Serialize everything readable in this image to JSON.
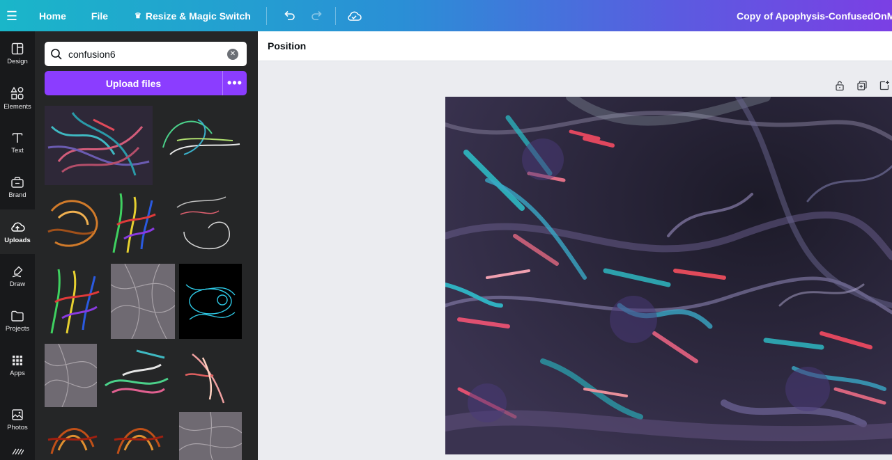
{
  "topbar": {
    "menu_icon": "hamburger-icon",
    "home_label": "Home",
    "file_label": "File",
    "resize_label": "Resize & Magic Switch",
    "resize_icon": "crown-icon",
    "undo_icon": "undo-icon",
    "redo_icon": "redo-icon",
    "cloud_icon": "cloud-check-icon",
    "document_title": "Copy of Apophysis-ConfusedOnMany"
  },
  "rail": {
    "items": [
      {
        "label": "Design",
        "icon": "design-icon"
      },
      {
        "label": "Elements",
        "icon": "elements-icon"
      },
      {
        "label": "Text",
        "icon": "text-icon"
      },
      {
        "label": "Brand",
        "icon": "brand-icon"
      },
      {
        "label": "Uploads",
        "icon": "upload-cloud-icon"
      },
      {
        "label": "Draw",
        "icon": "draw-icon"
      },
      {
        "label": "Projects",
        "icon": "folder-icon"
      },
      {
        "label": "Apps",
        "icon": "apps-grid-icon"
      },
      {
        "label": "Photos",
        "icon": "photos-icon"
      }
    ],
    "active": "Uploads"
  },
  "panel": {
    "search_value": "confusion6",
    "upload_label": "Upload files",
    "more_label": "•••",
    "collapse_glyph": "‹"
  },
  "context_toolbar": {
    "position_label": "Position"
  },
  "colors": {
    "accent_purple": "#8b3dff",
    "panel_bg": "#252627",
    "rail_bg": "#18191b",
    "canvas_bg": "#ebecf0"
  }
}
